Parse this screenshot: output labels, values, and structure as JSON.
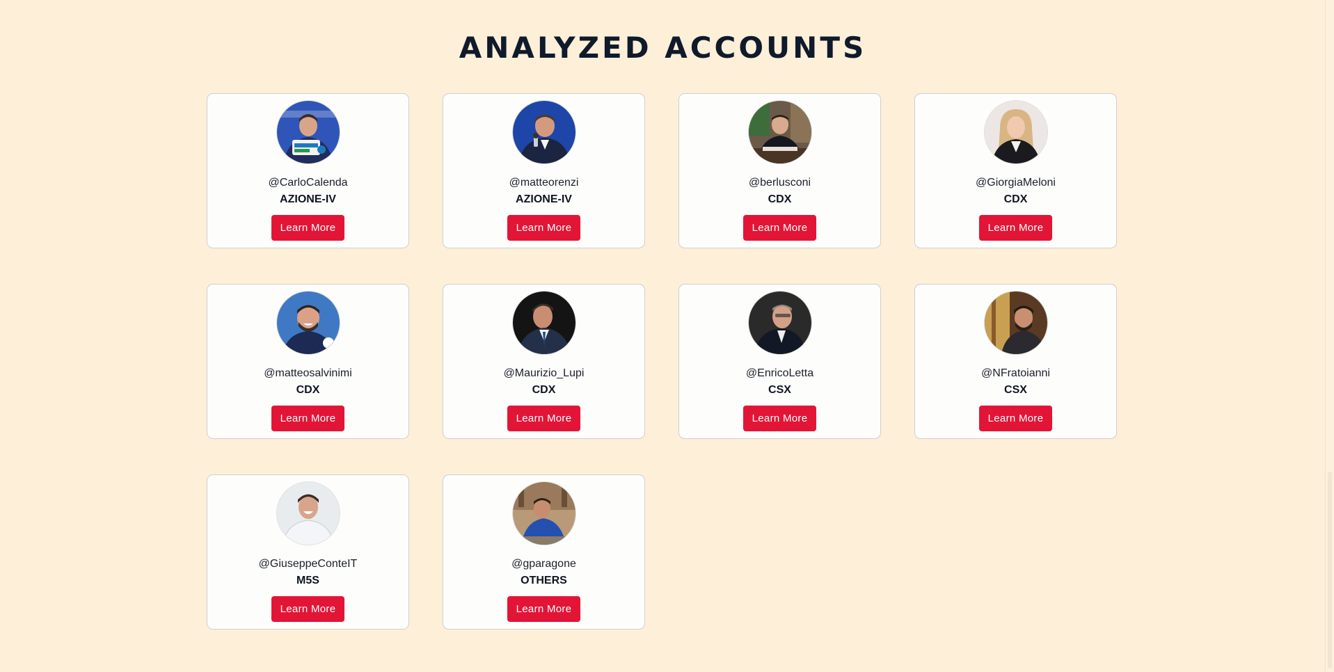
{
  "page": {
    "title": "ANALYZED ACCOUNTS",
    "background_color": "#feefd9",
    "accent_color": "#e21536"
  },
  "accounts": [
    {
      "handle": "@CarloCalenda",
      "party": "AZIONE-IV",
      "button_label": "Learn More",
      "avatar_icon": "avatar-photo-carlocalenda"
    },
    {
      "handle": "@matteorenzi",
      "party": "AZIONE-IV",
      "button_label": "Learn More",
      "avatar_icon": "avatar-photo-matteorenzi"
    },
    {
      "handle": "@berlusconi",
      "party": "CDX",
      "button_label": "Learn More",
      "avatar_icon": "avatar-photo-berlusconi"
    },
    {
      "handle": "@GiorgiaMeloni",
      "party": "CDX",
      "button_label": "Learn More",
      "avatar_icon": "avatar-photo-giorgiameloni"
    },
    {
      "handle": "@matteosalvinimi",
      "party": "CDX",
      "button_label": "Learn More",
      "avatar_icon": "avatar-photo-matteosalvinimi"
    },
    {
      "handle": "@Maurizio_Lupi",
      "party": "CDX",
      "button_label": "Learn More",
      "avatar_icon": "avatar-photo-maurizio-lupi"
    },
    {
      "handle": "@EnricoLetta",
      "party": "CSX",
      "button_label": "Learn More",
      "avatar_icon": "avatar-photo-enricoletta"
    },
    {
      "handle": "@NFratoianni",
      "party": "CSX",
      "button_label": "Learn More",
      "avatar_icon": "avatar-photo-nfratoianni"
    },
    {
      "handle": "@GiuseppeConteIT",
      "party": "M5S",
      "button_label": "Learn More",
      "avatar_icon": "avatar-photo-giuseppeconteit"
    },
    {
      "handle": "@gparagone",
      "party": "OTHERS",
      "button_label": "Learn More",
      "avatar_icon": "avatar-photo-gparagone"
    }
  ]
}
